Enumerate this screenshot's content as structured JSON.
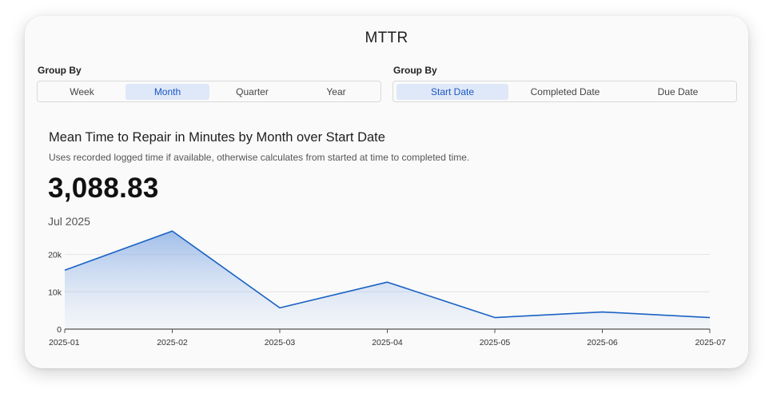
{
  "header": {
    "title": "MTTR"
  },
  "group_by_time": {
    "label": "Group By",
    "options": [
      "Week",
      "Month",
      "Quarter",
      "Year"
    ],
    "selected": "Month"
  },
  "group_by_date": {
    "label": "Group By",
    "options": [
      "Start Date",
      "Completed Date",
      "Due Date"
    ],
    "selected": "Start Date"
  },
  "metric": {
    "title": "Mean Time to Repair in Minutes by Month over Start Date",
    "subtitle": "Uses recorded logged time if available, otherwise calculates from started at time to completed time.",
    "value": "3,088.83",
    "period": "Jul 2025"
  },
  "colors": {
    "accent": "#1a62c4",
    "selected_bg": "#dfe8f8"
  },
  "chart_data": {
    "type": "area",
    "categories": [
      "2025-01",
      "2025-02",
      "2025-03",
      "2025-04",
      "2025-05",
      "2025-06",
      "2025-07"
    ],
    "values": [
      15800,
      26300,
      5700,
      12600,
      3100,
      4600,
      3089
    ],
    "y_ticks": [
      0,
      10000,
      20000
    ],
    "y_tick_labels": [
      "0",
      "10k",
      "20k"
    ],
    "ylim": [
      0,
      27000
    ],
    "grid": true
  }
}
